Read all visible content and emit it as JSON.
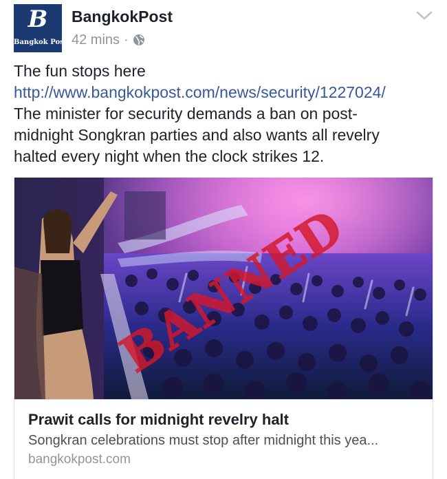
{
  "post": {
    "page_name": "BangkokPost",
    "avatar_letter": "B",
    "avatar_name": "Bangkok Post",
    "timestamp": "42 mins",
    "separator": "·",
    "privacy_icon": "globe-icon",
    "menu_icon": "chevron-down-icon",
    "message_lines": [
      "The fun stops here",
      "http://www.bangkokpost.com/news/security/1227024/",
      "The minister for security demands a ban on post-",
      "midnight Songkran parties and also wants all revelry",
      "halted every night when the clock strikes 12."
    ]
  },
  "link_card": {
    "image_stamp_text": "BANNED",
    "image_stamp_color": "#d3182b",
    "title": "Prawit calls for midnight revelry halt",
    "description": "Songkran celebrations must stop after midnight this yea...",
    "domain": "bangkokpost.com"
  },
  "colors": {
    "text": "#1d2129",
    "link": "#365899",
    "secondary": "#90949c",
    "brand": "#1b3a72"
  }
}
